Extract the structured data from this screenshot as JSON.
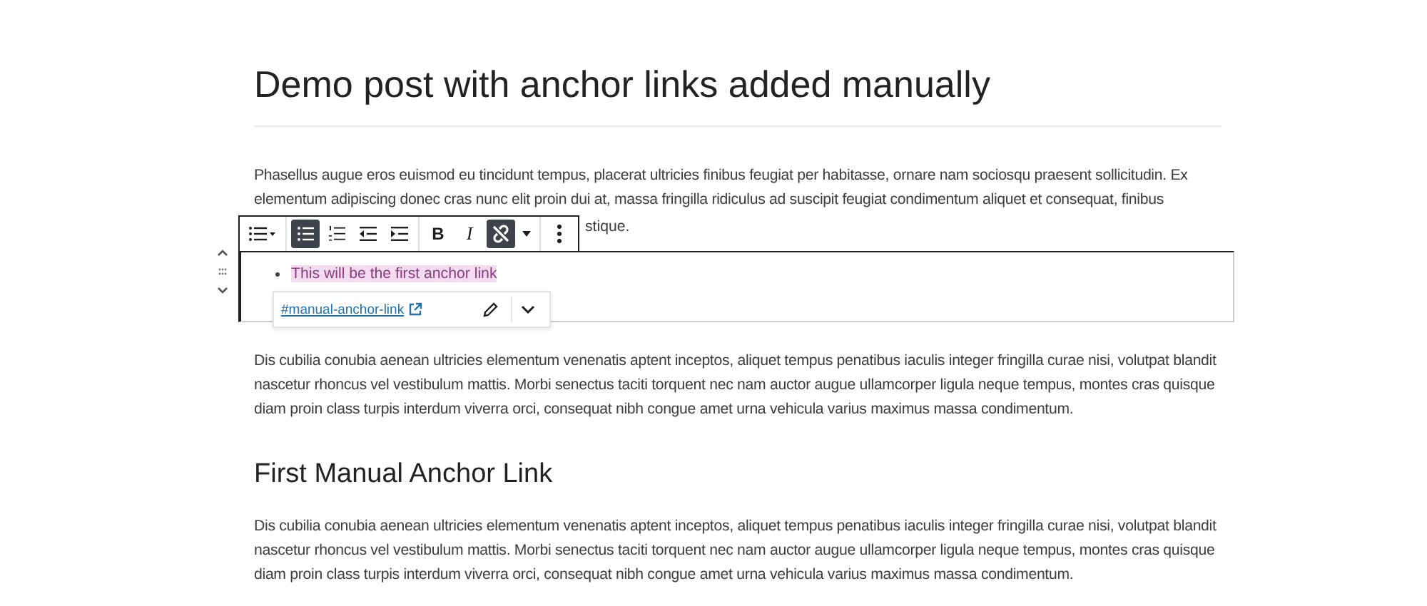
{
  "title": "Demo post with anchor links added manually",
  "intro_paragraph": {
    "lines": [
      "Phasellus augue eros euismod eu tincidunt tempus, placerat ultricies finibus feugiat per habitasse, ornare nam sociosqu praesent sollicitudin. Ex",
      "elementum adipiscing donec cras nunc elit proin dui at, massa fringilla ridiculus ad suscipit feugiat condimentum aliquet et consequat, finibus"
    ],
    "tail": "stique."
  },
  "toolbar": [
    {
      "kind": "list-type",
      "selected": false
    },
    {
      "kind": "bullets",
      "selected": true
    },
    {
      "kind": "numbers",
      "selected": false
    },
    {
      "kind": "outdent",
      "selected": false
    },
    {
      "kind": "indent",
      "selected": false
    },
    {
      "kind": "bold",
      "selected": false,
      "label": "B"
    },
    {
      "kind": "italic",
      "selected": false,
      "label": "I"
    },
    {
      "kind": "unlink",
      "selected": true
    },
    {
      "kind": "more",
      "selected": false
    },
    {
      "kind": "options",
      "selected": false
    }
  ],
  "list_item": {
    "text": "This will be the first anchor link",
    "highlighted": true
  },
  "link_popover": {
    "url": "#manual-anchor-link"
  },
  "paragraph_2": "Dis cubilia conubia aenean ultricies elementum venenatis aptent inceptos, aliquet tempus penatibus iaculis integer fringilla curae nisi, volutpat blandit nascetur rhoncus vel vestibulum mattis. Morbi senectus taciti torquent nec nam auctor augue ullamcorper ligula neque tempus, montes cras quisque diam proin class turpis interdum viverra orci, consequat nibh congue amet urna vehicula varius maximus massa condimentum.",
  "heading": "First Manual Anchor Link",
  "paragraph_3": "Dis cubilia conubia aenean ultricies elementum venenatis aptent inceptos, aliquet tempus penatibus iaculis integer fringilla curae nisi, volutpat blandit nascetur rhoncus vel vestibulum mattis. Morbi senectus taciti torquent nec nam auctor augue ullamcorper ligula neque tempus, montes cras quisque diam proin class turpis interdum viverra orci, consequat nibh congue amet urna vehicula varius maximus massa condimentum."
}
